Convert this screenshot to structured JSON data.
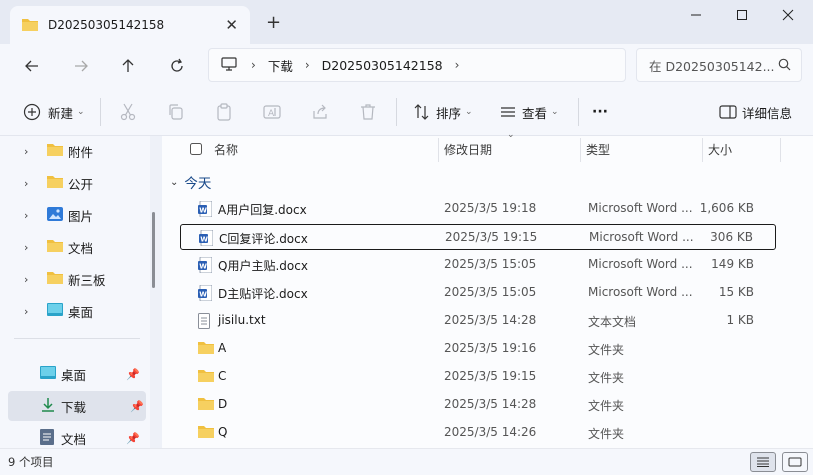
{
  "window": {
    "tab_title": "D20250305142158",
    "new_tab": "+",
    "minimize": "—",
    "maximize": "☐",
    "close": "✕",
    "tab_close": "✕"
  },
  "address": {
    "breadcrumbs": [
      "下载",
      "D20250305142158"
    ],
    "search_placeholder": "在 D20250305142..."
  },
  "toolbar": {
    "new_label": "新建",
    "sort_label": "排序",
    "view_label": "查看",
    "more_label": "···",
    "details_label": "详细信息"
  },
  "sidebar": {
    "tree_items": [
      {
        "label": "附件",
        "icon": "folder-icon"
      },
      {
        "label": "公开",
        "icon": "folder-icon"
      },
      {
        "label": "图片",
        "icon": "pictures-icon"
      },
      {
        "label": "文档",
        "icon": "folder-icon"
      },
      {
        "label": "新三板",
        "icon": "folder-icon"
      },
      {
        "label": "桌面",
        "icon": "desktop-icon"
      }
    ],
    "pinned_items": [
      {
        "label": "桌面",
        "icon": "desktop-icon"
      },
      {
        "label": "下载",
        "icon": "download-icon"
      },
      {
        "label": "文档",
        "icon": "document-icon"
      }
    ]
  },
  "columns": {
    "name": "名称",
    "date": "修改日期",
    "type": "类型",
    "size": "大小"
  },
  "group_label": "今天",
  "files": [
    {
      "name": "A用户回复.docx",
      "date": "2025/3/5 19:18",
      "type": "Microsoft Word ...",
      "size": "1,606 KB",
      "icon": "word-icon"
    },
    {
      "name": "C回复评论.docx",
      "date": "2025/3/5 19:15",
      "type": "Microsoft Word ...",
      "size": "306 KB",
      "icon": "word-icon"
    },
    {
      "name": "Q用户主贴.docx",
      "date": "2025/3/5 15:05",
      "type": "Microsoft Word ...",
      "size": "149 KB",
      "icon": "word-icon"
    },
    {
      "name": "D主贴评论.docx",
      "date": "2025/3/5 15:05",
      "type": "Microsoft Word ...",
      "size": "15 KB",
      "icon": "word-icon"
    },
    {
      "name": "jisilu.txt",
      "date": "2025/3/5 14:28",
      "type": "文本文档",
      "size": "1 KB",
      "icon": "text-file-icon"
    },
    {
      "name": "A",
      "date": "2025/3/5 19:16",
      "type": "文件夹",
      "size": "",
      "icon": "folder-icon"
    },
    {
      "name": "C",
      "date": "2025/3/5 19:15",
      "type": "文件夹",
      "size": "",
      "icon": "folder-icon"
    },
    {
      "name": "D",
      "date": "2025/3/5 14:28",
      "type": "文件夹",
      "size": "",
      "icon": "folder-icon"
    },
    {
      "name": "Q",
      "date": "2025/3/5 14:26",
      "type": "文件夹",
      "size": "",
      "icon": "folder-icon"
    }
  ],
  "status": {
    "item_count": "9 个项目"
  },
  "colors": {
    "folder": "#f0c040",
    "word": "#2b5fb4",
    "accent": "#1a4a8a"
  }
}
